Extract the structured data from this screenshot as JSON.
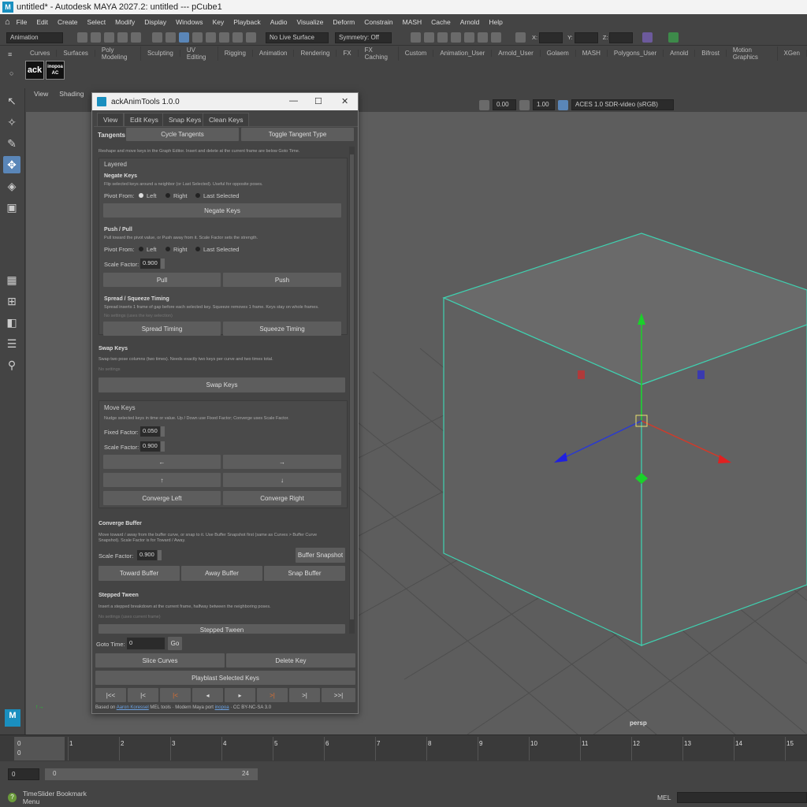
{
  "window": {
    "title": "untitled* - Autodesk MAYA 2027.2: untitled   ---   pCube1",
    "logo": "M"
  },
  "menu": [
    "File",
    "Edit",
    "Create",
    "Select",
    "Modify",
    "Display",
    "Windows",
    "Key",
    "Playback",
    "Audio",
    "Visualize",
    "Deform",
    "Constrain",
    "MASH",
    "Cache",
    "Arnold",
    "Help"
  ],
  "status": {
    "menuset": "Animation",
    "live_surface": "No Live Surface",
    "symmetry": "Symmetry: Off",
    "x_label": "X:",
    "y_label": "Y:",
    "z_label": "Z:"
  },
  "shelf_tabs": [
    "Curves",
    "Surfaces",
    "Poly Modeling",
    "Sculpting",
    "UV Editing",
    "Rigging",
    "Animation",
    "Rendering",
    "FX",
    "FX Caching",
    "Custom",
    "Animation_User",
    "Arnold_User",
    "Golaem",
    "MASH",
    "Polygons_User",
    "Arnold",
    "Bifrost",
    "Motion Graphics",
    "XGen"
  ],
  "shelf": {
    "ack_label": "ack",
    "inopoa_label": "inopoa",
    "ac_label": "AC"
  },
  "viewport": {
    "menu_view": "View",
    "menu_shading": "Shading",
    "exposure": "0.00",
    "gamma": "1.00",
    "colorspace": "ACES 1.0 SDR-video (sRGB)",
    "camera": "persp"
  },
  "tool": {
    "title": "ackAnimTools 1.0.0",
    "tabs": [
      "View",
      "Edit Keys",
      "Snap Keys",
      "Clean Keys"
    ],
    "tangents_label": "Tangents",
    "cycle_tangents": "Cycle Tangents",
    "toggle_tangent_type": "Toggle Tangent Type",
    "intro": "Reshape and move keys in the Graph Editor. Insert and delete at the current frame are below Goto Time.",
    "layered": "Layered",
    "negate": {
      "title": "Negate Keys",
      "desc": "Flip selected keys around a neighbor (or Last Selected). Useful for opposite poses.",
      "pivot_label": "Pivot From:",
      "left": "Left",
      "right": "Right",
      "last": "Last Selected",
      "button": "Negate Keys"
    },
    "pushpull": {
      "title": "Push / Pull",
      "desc": "Pull toward the pivot value, or Push away from it. Scale Factor sets the strength.",
      "pivot_label": "Pivot From:",
      "left": "Left",
      "right": "Right",
      "last": "Last Selected",
      "scale_label": "Scale Factor:",
      "scale_value": "0.900",
      "pull": "Pull",
      "push": "Push"
    },
    "spread": {
      "title": "Spread / Squeeze Timing",
      "desc": "Spread inserts 1 frame of gap before each selected key. Squeeze removes 1 frame. Keys stay on whole frames.",
      "note": "No settings (uses the key selection)",
      "spread": "Spread Timing",
      "squeeze": "Squeeze Timing"
    },
    "swap": {
      "title": "Swap Keys",
      "desc": "Swap two pose columns (two times). Needs exactly two keys per curve and two times total.",
      "note": "No settings",
      "button": "Swap Keys"
    },
    "move": {
      "title": "Move Keys",
      "desc": "Nudge selected keys in time or value. Up / Down use Fixed Factor; Converge uses Scale Factor.",
      "fixed_label": "Fixed Factor:",
      "fixed_value": "0.050",
      "scale_label": "Scale Factor:",
      "scale_value": "0.900",
      "left": "←",
      "right": "→",
      "up": "↑",
      "down": "↓",
      "conv_left": "Converge Left",
      "conv_right": "Converge Right"
    },
    "buffer": {
      "title": "Converge Buffer",
      "desc": "Move toward / away from the buffer curve, or snap to it. Use Buffer Snapshot first (same as Curves > Buffer Curve Snapshot). Scale Factor is for Toward / Away.",
      "scale_label": "Scale Factor:",
      "scale_value": "0.900",
      "snapshot": "Buffer Snapshot",
      "toward": "Toward Buffer",
      "away": "Away Buffer",
      "snap": "Snap Buffer"
    },
    "stepped": {
      "title": "Stepped Tween",
      "desc": "Insert a stepped breakdown at the current frame, halfway between the neighboring poses.",
      "note": "No settings (uses current frame)",
      "button": "Stepped Tween"
    },
    "goto_label": "Goto Time:",
    "goto_value": "0",
    "go": "Go",
    "slice": "Slice Curves",
    "delete": "Delete Key",
    "playblast": "Playblast Selected Keys",
    "nav": [
      "|<<",
      "|<",
      "|<",
      "◂",
      "▸",
      ">|",
      ">|",
      ">>|"
    ],
    "footer_prefix": "Based on",
    "footer_author": "Aaron Koressel",
    "footer_mid": "MEL tools · Modern Maya port",
    "footer_port": "inopoa",
    "footer_license": "· CC BY-NC-SA 3.0"
  },
  "timeline": {
    "frames": [
      "0",
      "1",
      "2",
      "3",
      "4",
      "5",
      "6",
      "7",
      "8",
      "9",
      "10",
      "11",
      "12",
      "13",
      "14",
      "15"
    ],
    "current": "0"
  },
  "range": {
    "start": "0",
    "inner_start": "0",
    "inner_end": "24"
  },
  "cmd": {
    "bookmark": "TimeSlider Bookmark Menu",
    "mel": "MEL"
  }
}
